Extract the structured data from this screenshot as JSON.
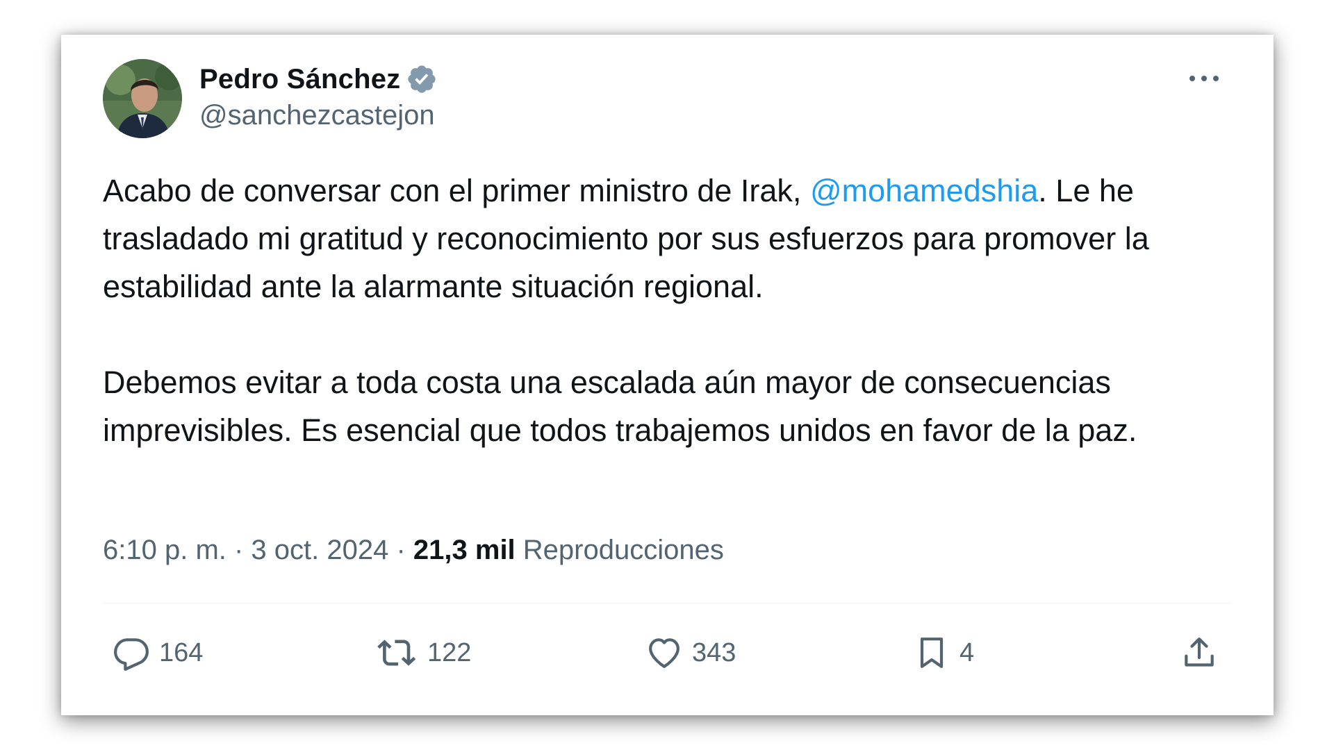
{
  "author": {
    "name": "Pedro Sánchez",
    "handle": "@sanchezcastejon",
    "verified_icon": "verified-badge-icon"
  },
  "tweet": {
    "line1_before_mention": "Acabo de conversar con el primer ministro de Irak, ",
    "mention": "@mohamedshia",
    "line1_after_mention": ". Le he trasladado mi gratitud y reconocimiento por sus esfuerzos para promover la estabilidad ante la alarmante situación regional.",
    "paragraph2": "Debemos evitar a toda costa una escalada aún mayor de consecuencias imprevisibles. Es esencial que todos trabajemos unidos en favor de la paz."
  },
  "meta": {
    "time": "6:10 p. m.",
    "separator": " · ",
    "date": "3 oct. 2024",
    "views_count": "21,3 mil",
    "views_label": " Reproducciones"
  },
  "actions": {
    "replies": "164",
    "retweets": "122",
    "likes": "343",
    "bookmarks": "4"
  },
  "colors": {
    "mention": "#1d9bf0",
    "text": "#0f1419",
    "secondary": "#536471",
    "verified": "#829aab"
  }
}
